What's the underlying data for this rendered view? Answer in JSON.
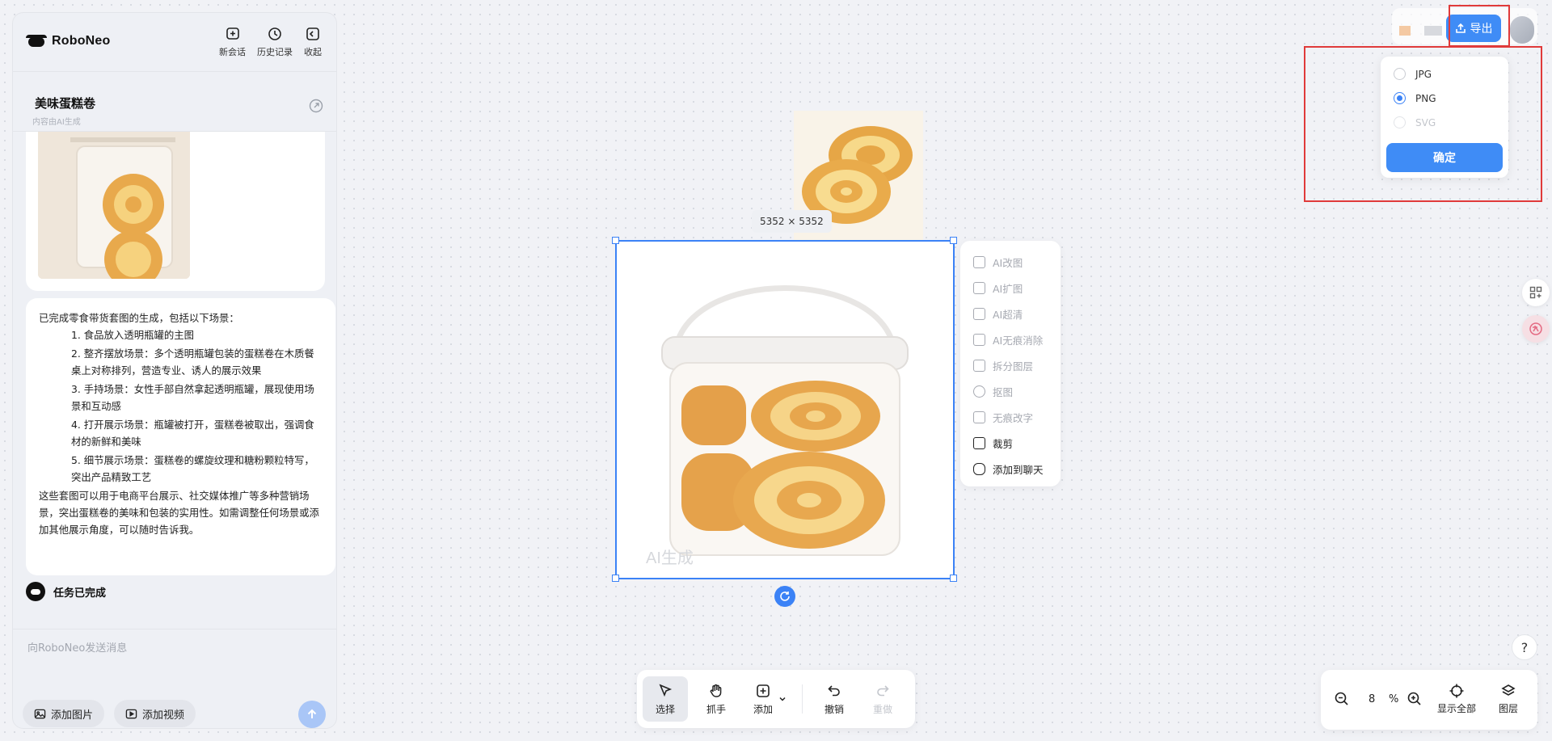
{
  "app": {
    "logo_text": "RoboNeo"
  },
  "header_actions": [
    {
      "label": "新会话",
      "icon": "new-chat-icon"
    },
    {
      "label": "历史记录",
      "icon": "history-icon"
    },
    {
      "label": "收起",
      "icon": "collapse-icon"
    }
  ],
  "conversation": {
    "title": "美味蛋糕卷",
    "subtitle": "内容由AI生成"
  },
  "message": {
    "intro": "已完成零食带货套图的生成，包括以下场景：",
    "items": [
      "1. 食品放入透明瓶罐的主图",
      "2. 整齐摆放场景：多个透明瓶罐包装的蛋糕卷在木质餐桌上对称排列，营造专业、诱人的展示效果",
      "3. 手持场景：女性手部自然拿起透明瓶罐，展现使用场景和互动感",
      "4. 打开展示场景：瓶罐被打开，蛋糕卷被取出，强调食材的新鲜和美味",
      "5. 细节展示场景：蛋糕卷的螺旋纹理和糖粉颗粒特写，突出产品精致工艺"
    ],
    "outro": "这些套图可以用于电商平台展示、社交媒体推广等多种营销场景，突出蛋糕卷的美味和包装的实用性。如需调整任何场景或添加其他展示角度，可以随时告诉我。"
  },
  "status": {
    "text": "任务已完成"
  },
  "composer": {
    "placeholder": "向RoboNeo发送消息",
    "add_image": "添加图片",
    "add_video": "添加视频"
  },
  "canvas": {
    "size_label": "5352 × 5352",
    "watermark": "AI生成"
  },
  "tools_menu": [
    {
      "label": "AI改图",
      "enabled": false
    },
    {
      "label": "AI扩图",
      "enabled": false
    },
    {
      "label": "AI超清",
      "enabled": false
    },
    {
      "label": "AI无痕消除",
      "enabled": false
    },
    {
      "label": "拆分图层",
      "enabled": false
    },
    {
      "label": "抠图",
      "enabled": false
    },
    {
      "label": "无痕改字",
      "enabled": false
    },
    {
      "label": "裁剪",
      "enabled": true
    },
    {
      "label": "添加到聊天",
      "enabled": true
    }
  ],
  "export": {
    "button_label": "导出",
    "formats": [
      {
        "label": "JPG",
        "selected": false,
        "enabled": true
      },
      {
        "label": "PNG",
        "selected": true,
        "enabled": true
      },
      {
        "label": "SVG",
        "selected": false,
        "enabled": false
      }
    ],
    "confirm_label": "确定"
  },
  "bottom_toolbar": [
    {
      "label": "选择",
      "icon": "select-cursor-icon",
      "selected": true
    },
    {
      "label": "抓手",
      "icon": "hand-icon",
      "selected": false
    },
    {
      "label": "添加",
      "icon": "add-icon",
      "selected": false
    },
    {
      "label": "撤销",
      "icon": "undo-icon",
      "selected": false
    },
    {
      "label": "重做",
      "icon": "redo-icon",
      "selected": false,
      "disabled": true
    }
  ],
  "zoom": {
    "value": "8",
    "unit": "%",
    "fit_label": "显示全部",
    "layers_label": "图层"
  },
  "help_label": "?",
  "colors": {
    "accent": "#3f8cf6",
    "highlight": "#e03a3a",
    "canvas_bg": "#f1f2f6"
  }
}
